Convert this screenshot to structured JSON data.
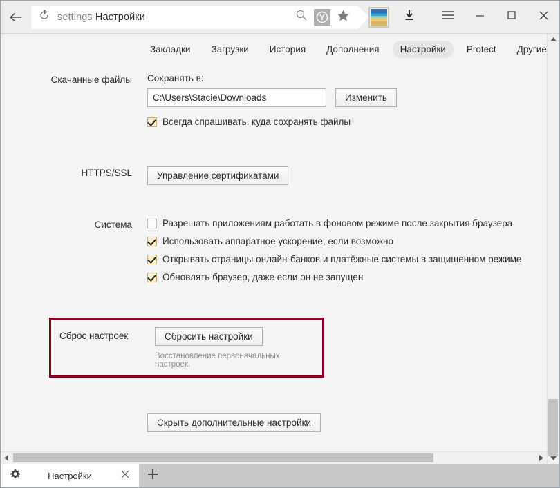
{
  "window": {
    "address": {
      "scheme_text": "settings",
      "page_text": "Настройки"
    },
    "controls": {
      "back": "back-arrow",
      "reload": "reload",
      "menu": "menu",
      "minimize": "minimize",
      "maximize": "maximize",
      "close": "close"
    }
  },
  "nav": {
    "tabs": [
      {
        "label": "Закладки",
        "active": false
      },
      {
        "label": "Загрузки",
        "active": false
      },
      {
        "label": "История",
        "active": false
      },
      {
        "label": "Дополнения",
        "active": false
      },
      {
        "label": "Настройки",
        "active": true
      },
      {
        "label": "Protect",
        "active": false
      },
      {
        "label": "Другие устройства",
        "active": false
      }
    ]
  },
  "settings": {
    "downloads": {
      "label": "Скачанные файлы",
      "save_to_label": "Сохранять в:",
      "path_value": "C:\\Users\\Stacie\\Downloads",
      "change_button": "Изменить",
      "always_ask": {
        "label": "Всегда спрашивать, куда сохранять файлы",
        "checked": true
      }
    },
    "https_ssl": {
      "label": "HTTPS/SSL",
      "manage_certs_button": "Управление сертификатами"
    },
    "system": {
      "label": "Система",
      "options": [
        {
          "label": "Разрешать приложениям работать в фоновом режиме после закрытия браузера",
          "checked": false
        },
        {
          "label": "Использовать аппаратное ускорение, если возможно",
          "checked": true
        },
        {
          "label": "Открывать страницы онлайн-банков и платёжные системы в защищенном режиме",
          "checked": true
        },
        {
          "label": "Обновлять браузер, даже если он не запущен",
          "checked": true
        }
      ]
    },
    "reset": {
      "label": "Сброс настроек",
      "button": "Сбросить настройки",
      "description": "Восстановление первоначальных настроек.",
      "highlight_color": "#8b0021"
    },
    "hide_advanced_button": "Скрыть дополнительные настройки"
  },
  "tabstrip": {
    "tab_title": "Настройки",
    "favicon": "gear-icon",
    "close": "close-icon",
    "new_tab": "plus-icon"
  }
}
